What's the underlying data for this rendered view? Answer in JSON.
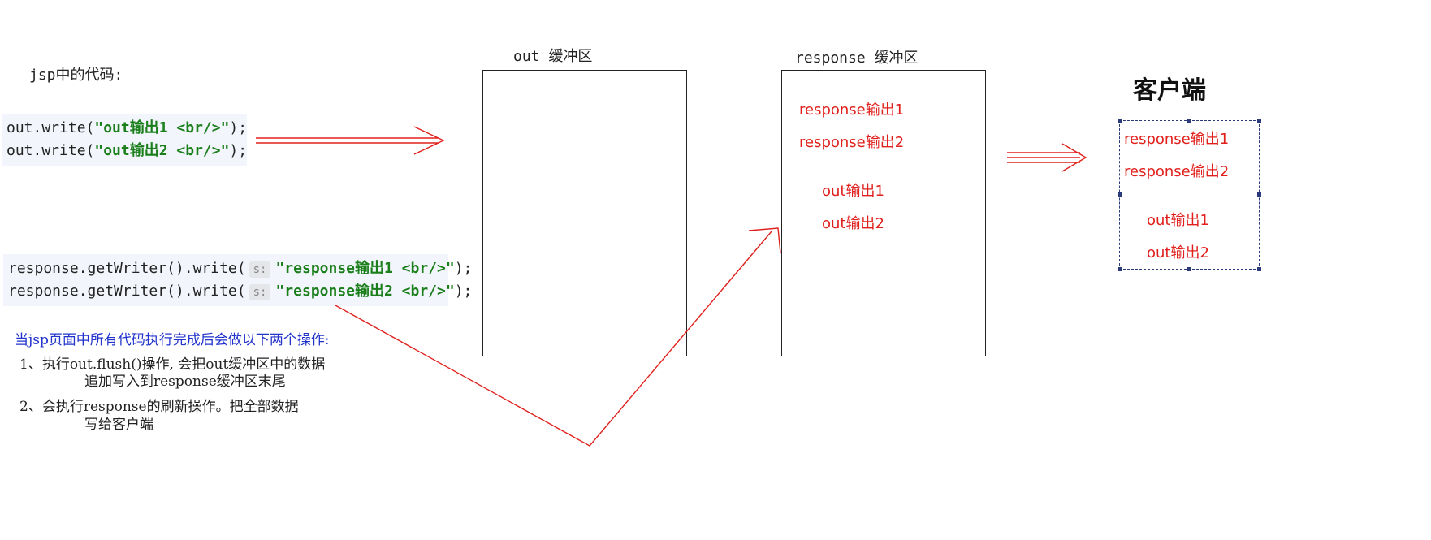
{
  "jsp_label": "jsp中的代码:",
  "out_code": {
    "lines": [
      {
        "prefix": "out.write(",
        "string": "\"out输出1 <br/>\"",
        "suffix": ");"
      },
      {
        "prefix": "out.write(",
        "string": "\"out输出2 <br/>\"",
        "suffix": ");"
      }
    ]
  },
  "response_code": {
    "lines": [
      {
        "prefix": "response.getWriter().write(",
        "hint": "s:",
        "string": "\"response输出1 <br/>\"",
        "suffix": ");"
      },
      {
        "prefix": "response.getWriter().write(",
        "hint": "s:",
        "string": "\"response输出2 <br/>\"",
        "suffix": ");"
      }
    ]
  },
  "out_buffer": {
    "title": "out 缓冲区"
  },
  "response_buffer": {
    "title": "response 缓冲区",
    "items": [
      "response输出1",
      "response输出2",
      "out输出1",
      "out输出2"
    ]
  },
  "client": {
    "title": "客户端",
    "items": [
      "response输出1",
      "response输出2",
      "out输出1",
      "out输出2"
    ]
  },
  "notes": {
    "title": "当jsp页面中所有代码执行完成后会做以下两个操作:",
    "step1_line1": "1、执行out.flush()操作, 会把out缓冲区中的数据",
    "step1_line2": "追加写入到response缓冲区末尾",
    "step2_line1": "2、会执行response的刷新操作。把全部数据",
    "step2_line2": "写给客户端"
  },
  "colors": {
    "arrow": "#e0201c",
    "output_text": "#e0201c",
    "string_literal": "#1a7f1a",
    "notes_title": "#2233cc",
    "client_border": "#2b3a7a"
  }
}
